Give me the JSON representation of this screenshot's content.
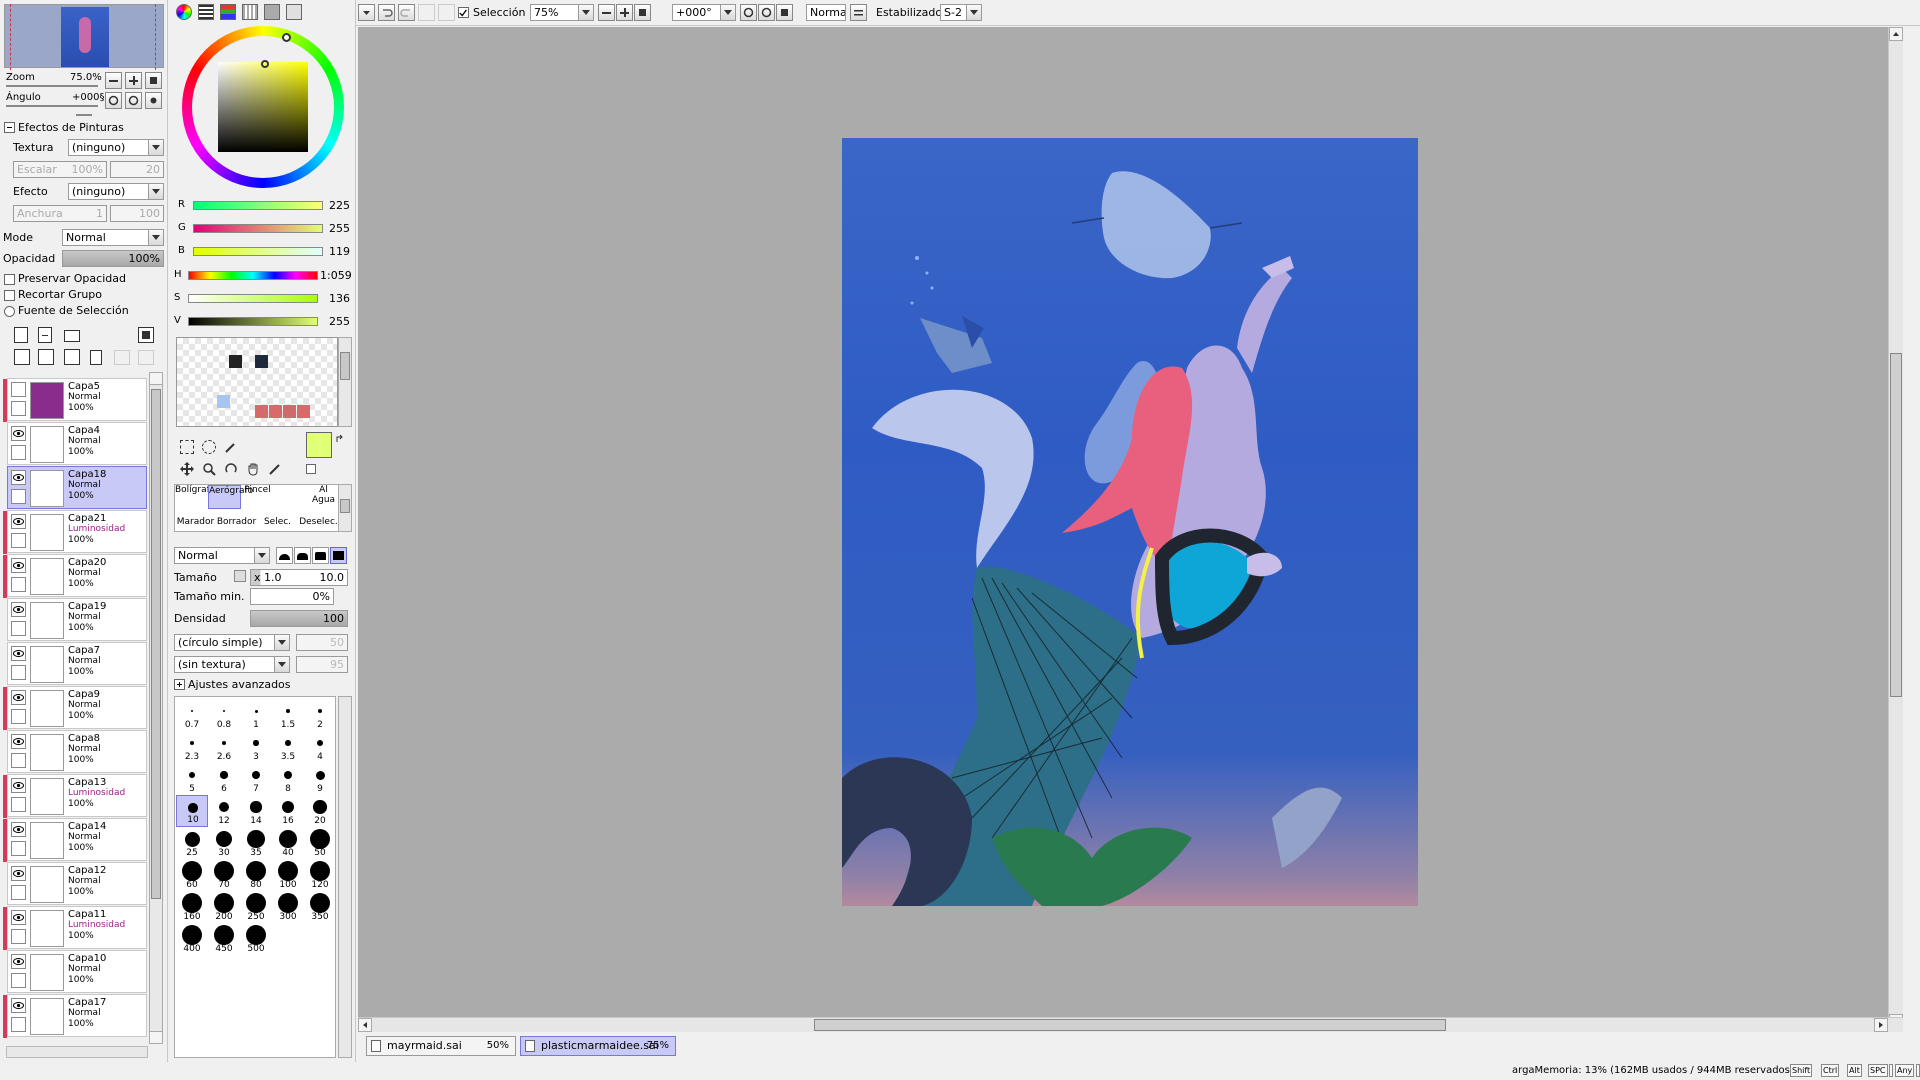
{
  "navigator": {
    "zoom_label": "Zoom",
    "zoom_value": "75.0%",
    "angle_label": "Ángulo",
    "angle_value": "+000§"
  },
  "paint_effects": {
    "header": "Efectos de Pinturas",
    "texture_label": "Textura",
    "texture_value": "(ninguno)",
    "scale_label": "Escalar",
    "scale_value": "100%",
    "scale_right": "20",
    "effect_label": "Efecto",
    "effect_value": "(ninguno)",
    "width_label": "Anchura",
    "width_value": "1",
    "width_right": "100"
  },
  "layer_props": {
    "mode_label": "Mode",
    "mode_value": "Normal",
    "opacity_label": "Opacidad",
    "opacity_value": "100%",
    "preserve_opacity": "Preservar Opacidad",
    "clip_group": "Recortar Grupo",
    "selection_source": "Fuente de Selección"
  },
  "layers": [
    {
      "name": "Capa5",
      "mode": "Normal",
      "opacity": "100%",
      "thumb": "#8a2c8a",
      "mark": true,
      "visible": false
    },
    {
      "name": "Capa4",
      "mode": "Normal",
      "opacity": "100%",
      "thumb": "#ffffff",
      "mark": false,
      "visible": true
    },
    {
      "name": "Capa18",
      "mode": "Normal",
      "opacity": "100%",
      "thumb": "#ffffff",
      "mark": false,
      "visible": true,
      "selected": true
    },
    {
      "name": "Capa21",
      "mode": "Luminosidad",
      "opacity": "100%",
      "thumb": "#ffffff",
      "mark": true,
      "visible": true
    },
    {
      "name": "Capa20",
      "mode": "Normal",
      "opacity": "100%",
      "thumb": "#ffffff",
      "mark": true,
      "visible": true
    },
    {
      "name": "Capa19",
      "mode": "Normal",
      "opacity": "100%",
      "thumb": "#ffffff",
      "mark": false,
      "visible": true
    },
    {
      "name": "Capa7",
      "mode": "Normal",
      "opacity": "100%",
      "thumb": "#ffffff",
      "mark": false,
      "visible": true
    },
    {
      "name": "Capa9",
      "mode": "Normal",
      "opacity": "100%",
      "thumb": "#ffffff",
      "mark": true,
      "visible": true
    },
    {
      "name": "Capa8",
      "mode": "Normal",
      "opacity": "100%",
      "thumb": "#ffffff",
      "mark": false,
      "visible": true
    },
    {
      "name": "Capa13",
      "mode": "Luminosidad",
      "opacity": "100%",
      "thumb": "#ffffff",
      "mark": true,
      "visible": true
    },
    {
      "name": "Capa14",
      "mode": "Normal",
      "opacity": "100%",
      "thumb": "#ffffff",
      "mark": true,
      "visible": true
    },
    {
      "name": "Capa12",
      "mode": "Normal",
      "opacity": "100%",
      "thumb": "#ffffff",
      "mark": false,
      "visible": true
    },
    {
      "name": "Capa11",
      "mode": "Luminosidad",
      "opacity": "100%",
      "thumb": "#ffffff",
      "mark": true,
      "visible": true
    },
    {
      "name": "Capa10",
      "mode": "Normal",
      "opacity": "100%",
      "thumb": "#ffffff",
      "mark": false,
      "visible": true
    },
    {
      "name": "Capa17",
      "mode": "Normal",
      "opacity": "100%",
      "thumb": "#ffffff",
      "mark": true,
      "visible": true
    }
  ],
  "color": {
    "r_label": "R",
    "r_value": "225",
    "g_label": "G",
    "g_value": "255",
    "b_label": "B",
    "b_value": "119",
    "h_label": "H",
    "h_value": "1:059",
    "s_label": "S",
    "s_value": "136",
    "v_label": "V",
    "v_value": "255",
    "primary": "#e1ff77"
  },
  "tools": {
    "brushes_row1": [
      "Bolígrafo",
      "Aerógrafo",
      "Pincel",
      "",
      "Al Agua"
    ],
    "brushes_row2": [
      "Marador",
      "Borrador",
      "Selec.",
      "Deselec."
    ]
  },
  "brush_settings": {
    "blend_value": "Normal",
    "size_label": "Tamaño",
    "size_mult": "x 1.0",
    "size_value": "10.0",
    "min_size_label": "Tamaño min.",
    "min_size_value": "0%",
    "density_label": "Densidad",
    "density_value": "100",
    "shape_value": "(círculo simple)",
    "shape_right": "50",
    "texture_value": "(sin textura)",
    "texture_right": "95",
    "advanced": "Ajustes avanzados"
  },
  "brush_sizes": [
    "0.7",
    "0.8",
    "1",
    "1.5",
    "2",
    "2.3",
    "2.6",
    "3",
    "3.5",
    "4",
    "5",
    "6",
    "7",
    "8",
    "9",
    "10",
    "12",
    "14",
    "16",
    "20",
    "25",
    "30",
    "35",
    "40",
    "50",
    "60",
    "70",
    "80",
    "100",
    "120",
    "160",
    "200",
    "250",
    "300",
    "350",
    "400",
    "450",
    "500"
  ],
  "toolbar": {
    "selection_label": "Selección",
    "zoom_value": "75%",
    "angle_value": "+000°",
    "blend_value": "Normal",
    "stabilizer_label": "Estabilizador",
    "stabilizer_value": "S-2"
  },
  "tabs": [
    {
      "name": "mayrmaid.sai",
      "zoom": "50%",
      "active": false
    },
    {
      "name": "plasticmarmaidee.sai",
      "zoom": "75%",
      "active": true
    }
  ],
  "status": {
    "memory": "argaMemoria: 13% (162MB usados / 944MB reservados)",
    "keys": [
      "Shift",
      "Ctrl",
      "Alt",
      "SPC",
      "",
      "Any",
      ""
    ]
  }
}
